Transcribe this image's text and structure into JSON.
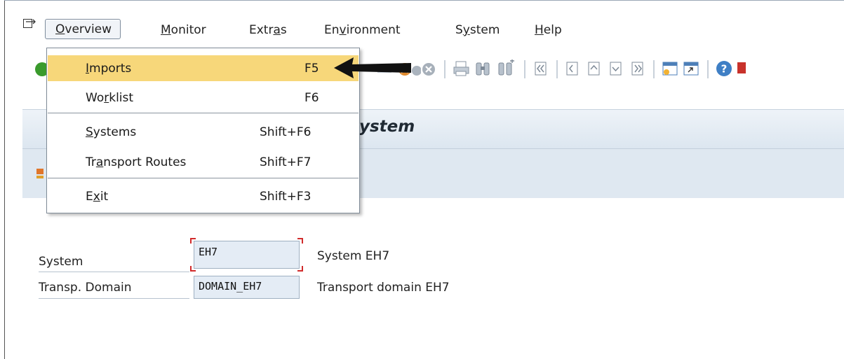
{
  "menu_bar": {
    "items": [
      {
        "label_pre": "",
        "label_u": "O",
        "label_post": "verview"
      },
      {
        "label_pre": "",
        "label_u": "M",
        "label_post": "onitor"
      },
      {
        "label_pre": "Extr",
        "label_u": "a",
        "label_post": "s"
      },
      {
        "label_pre": "En",
        "label_u": "v",
        "label_post": "ironment"
      },
      {
        "label_pre": "S",
        "label_u": "y",
        "label_post": "stem"
      },
      {
        "label_pre": "",
        "label_u": "H",
        "label_post": "elp"
      }
    ]
  },
  "dropdown": {
    "items": [
      {
        "label_pre": "",
        "label_u": "I",
        "label_post": "mports",
        "shortcut": "F5",
        "highlighted": true
      },
      {
        "label_pre": "Wo",
        "label_u": "r",
        "label_post": "klist",
        "shortcut": "F6"
      },
      {
        "label_pre": "",
        "label_u": "S",
        "label_post": "ystems",
        "shortcut": "Shift+F6"
      },
      {
        "label_pre": "Tr",
        "label_u": "a",
        "label_post": "nsport Routes",
        "shortcut": "Shift+F7"
      },
      {
        "label_pre": "E",
        "label_u": "x",
        "label_post": "it",
        "shortcut": "Shift+F3"
      }
    ]
  },
  "title": "ystem",
  "form": {
    "system_label": "System",
    "system_value": "EH7",
    "system_desc": "System EH7",
    "domain_label": "Transp. Domain",
    "domain_value": "DOMAIN_EH7",
    "domain_desc": "Transport domain EH7"
  },
  "colors": {
    "highlight": "#f7d77a",
    "field_bg": "#e4ecf5",
    "focus_corner": "#d12b2b",
    "title_band": "#dce6f0"
  },
  "icons": [
    "menu-toggle-icon",
    "green-check-icon",
    "back-icon",
    "exit-icon",
    "cancel-icon",
    "print-icon",
    "find-icon",
    "find-next-icon",
    "first-page-icon",
    "previous-page-icon",
    "next-page-icon",
    "last-page-icon",
    "create-session-icon",
    "shortcut-icon",
    "help-icon",
    "layout-icon",
    "arrow-pointer"
  ]
}
